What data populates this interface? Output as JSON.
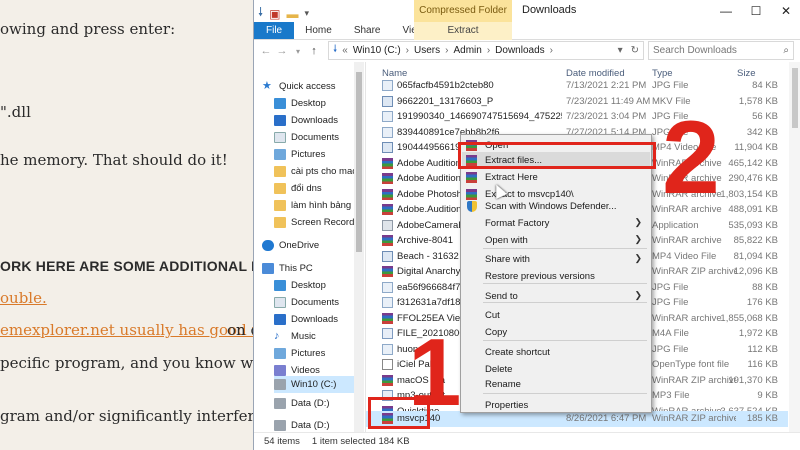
{
  "article": {
    "lines": [
      "owing and press enter:",
      "\".dll",
      "he memory. That should do it!",
      "ORK HERE ARE SOME ADDITIONAL RESOURC",
      "ouble.",
      "emexplorer.net usually has good intel",
      "on co",
      "pecific program, and you know which one,",
      "gram and/or significantly interferes with usa"
    ]
  },
  "window": {
    "title": "Downloads",
    "contextual_group": "Compressed Folder Tools",
    "tabs": [
      "File",
      "Home",
      "Share",
      "View"
    ],
    "contextual_tab": "Extract",
    "controls": [
      "—",
      "☐",
      "✕"
    ]
  },
  "address": {
    "crumbs": [
      "Win10 (C:)",
      "Users",
      "Admin",
      "Downloads"
    ],
    "search_placeholder": "Search Downloads"
  },
  "nav": {
    "quick_access": "Quick access",
    "items": [
      "Desktop",
      "Downloads",
      "Documents",
      "Pictures",
      "cài pts cho mac",
      "đổi dns",
      "làm hình bảng c",
      "Screen Record"
    ],
    "onedrive": "OneDrive",
    "this_pc": "This PC",
    "pc_items": [
      "Desktop",
      "Documents",
      "Downloads",
      "Music",
      "Pictures",
      "Videos",
      "Win10 (C:)",
      "Data (D:)"
    ],
    "extra": "Data (D:)"
  },
  "columns": {
    "name": "Name",
    "date": "Date modified",
    "type": "Type",
    "size": "Size"
  },
  "files": [
    {
      "name": "065facfb4591b2cteb80",
      "date": "7/13/2021 2:21 PM",
      "type": "JPG File",
      "size": "84 KB",
      "icon": "img"
    },
    {
      "name": "9662201_13176603_P",
      "date": "7/23/2021 11:49 AM",
      "type": "MKV File",
      "size": "1,578 KB",
      "icon": "vid"
    },
    {
      "name": "191990340_146690747515694_4752256005...",
      "date": "7/23/2021 3:04 PM",
      "type": "JPG File",
      "size": "56 KB",
      "icon": "img"
    },
    {
      "name": "839440891ce7ebb8b2f6",
      "date": "7/27/2021 5:14 PM",
      "type": "JPG File",
      "size": "342 KB",
      "icon": "img"
    },
    {
      "name": "1904449566192837",
      "date": "",
      "type": "MP4 Video File",
      "size": "11,904 KB",
      "icon": "vid"
    },
    {
      "name": "Adobe Audition",
      "date": "",
      "type": "WinRAR archive",
      "size": "465,142 KB",
      "icon": "rar"
    },
    {
      "name": "Adobe Audition",
      "date": "",
      "type": "WinRAR archive",
      "size": "290,476 KB",
      "icon": "rar"
    },
    {
      "name": "Adobe Photosho",
      "date": "",
      "type": "WinRAR archive",
      "size": "1,803,154 KB",
      "icon": "rar"
    },
    {
      "name": "Adobe.Audition.2",
      "date": "",
      "type": "WinRAR archive",
      "size": "488,091 KB",
      "icon": "rar"
    },
    {
      "name": "AdobeCameraRaw",
      "date": "",
      "type": "Application",
      "size": "535,093 KB",
      "icon": "app"
    },
    {
      "name": "Archive-8041",
      "date": "",
      "type": "WinRAR archive",
      "size": "85,822 KB",
      "icon": "rar"
    },
    {
      "name": "Beach - 31632",
      "date": "",
      "type": "MP4 Video File",
      "size": "81,094 KB",
      "icon": "vid"
    },
    {
      "name": "Digital Anarchy B",
      "date": "",
      "type": "WinRAR ZIP archive",
      "size": "12,096 KB",
      "icon": "rar"
    },
    {
      "name": "ea56f966684f7f1",
      "date": "",
      "type": "JPG File",
      "size": "88 KB",
      "icon": "img"
    },
    {
      "name": "f312631a7df18aaf",
      "date": "",
      "type": "JPG File",
      "size": "176 KB",
      "icon": "img"
    },
    {
      "name": "FFOL25EA Vietna",
      "date": "",
      "type": "WinRAR archive",
      "size": "1,855,068 KB",
      "icon": "rar"
    },
    {
      "name": "FILE_20210806_18",
      "date": "",
      "type": "M4A File",
      "size": "1,972 KB",
      "icon": "aud"
    },
    {
      "name": "huong",
      "date": "",
      "type": "JPG File",
      "size": "112 KB",
      "icon": "img"
    },
    {
      "name": "iCiel Pako",
      "date": "",
      "type": "OpenType font file",
      "size": "116 KB",
      "icon": "font"
    },
    {
      "name": "macOS Tra",
      "date": "",
      "type": "WinRAR ZIP archive",
      "size": "191,370 KB",
      "icon": "rar"
    },
    {
      "name": "mp3-output",
      "date": "",
      "type": "MP3 File",
      "size": "9 KB",
      "icon": "aud"
    },
    {
      "name": "Quicktime",
      "date": "",
      "type": "WinRAR archive",
      "size": "3,637,524 KB",
      "icon": "rar"
    },
    {
      "name": "msvcp140",
      "date": "8/26/2021 6:47 PM",
      "type": "WinRAR ZIP archive",
      "size": "185 KB",
      "icon": "rar",
      "selected": true
    }
  ],
  "status": {
    "count": "54 items",
    "selection": "1 item selected 184 KB"
  },
  "context_menu": {
    "items": [
      {
        "label": "Open",
        "icon": "rar"
      },
      {
        "label": "Extract files...",
        "icon": "rar",
        "hover": true
      },
      {
        "label": "Extract Here",
        "icon": "rar"
      },
      {
        "label": "Extract to msvcp140\\",
        "icon": "rar"
      },
      {
        "label": "Scan with Windows Defender...",
        "icon": "shield"
      },
      {
        "label": "Format Factory",
        "submenu": true
      },
      {
        "label": "Open with",
        "submenu": true
      },
      {
        "label": "Share with",
        "submenu": true
      },
      {
        "label": "Restore previous versions"
      },
      {
        "label": "Send to",
        "submenu": true
      },
      {
        "label": "Cut"
      },
      {
        "label": "Copy"
      },
      {
        "label": "Create shortcut"
      },
      {
        "label": "Delete"
      },
      {
        "label": "Rename"
      },
      {
        "label": "Properties"
      }
    ]
  },
  "annotations": {
    "step1": "1",
    "step2": "2",
    "accent": "#e0251b"
  }
}
